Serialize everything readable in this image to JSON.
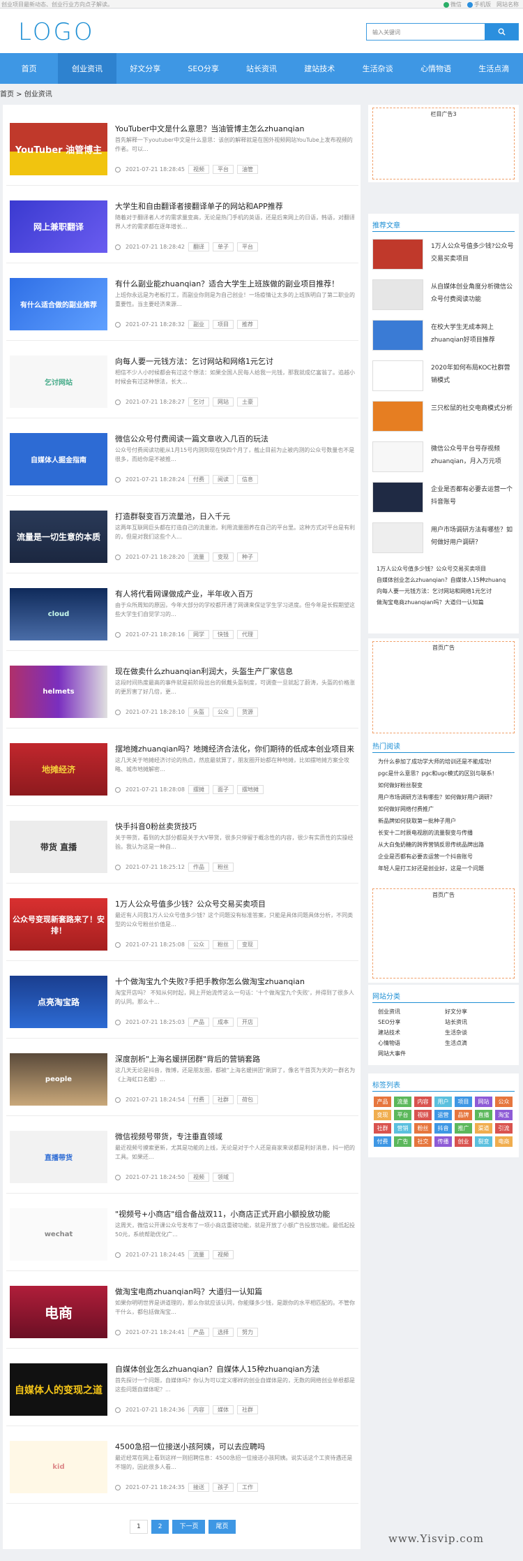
{
  "topbar": {
    "notice": "创业项目最新动态、创业行业方向点子解读。",
    "links": [
      {
        "label": "微信",
        "color": "#2aae67"
      },
      {
        "label": "手机版",
        "color": "#2b8fde"
      },
      {
        "label": "网站名称",
        "color": ""
      }
    ]
  },
  "header": {
    "logo": "LOGO",
    "search_placeholder": "输入关键词"
  },
  "nav": [
    "首页",
    "创业资讯",
    "好文分享",
    "SEO分享",
    "站长资讯",
    "建站技术",
    "生活杂谈",
    "心情物语",
    "生活点滴"
  ],
  "breadcrumb": "首页 > 创业资讯",
  "posts": [
    {
      "title": "YouTuber中文是什么意思？当油管博主怎么zhuanqian",
      "excerpt": "首先解释一下youtuber中文是什么意思：该创的解释就是在国外视频网站YouTube上发布视频的作者。可以...",
      "date": "2021-07-21 18:28:45",
      "tags": [
        "视频",
        "平台",
        "油管"
      ],
      "thumb_text": "YouTuber 油管博主"
    },
    {
      "title": "大学生和自由翻译者接翻译单子的网站和APP推荐",
      "excerpt": "随着对于翻译者人才的需求量变高，无论是热门手机的英语，还是后来网上的日语，韩语，对翻译界人才的需求都在逐年增长...",
      "date": "2021-07-21 18:28:42",
      "tags": [
        "翻译",
        "单子",
        "平台"
      ],
      "thumb_text": "网上兼职翻译"
    },
    {
      "title": "有什么副业能zhuanqian？适合大学生上班族做的副业项目推荐！",
      "excerpt": "上班你永远是为老板打工，而副业你则是为自己创业！一场疫情让太多的上班族明白了第二职业的重要性。当主要经济来源...",
      "date": "2021-07-21 18:28:32",
      "tags": [
        "副业",
        "项目",
        "推荐"
      ],
      "thumb_text": "有什么适合做的副业推荐"
    },
    {
      "title": "向每人要一元钱方法：乞讨网站和网络1元乞讨",
      "excerpt": "相信不少人小时候都会有过这个想法：如果全国人民每人给我一元钱，那我就成亿富翁了。追越小时候会有过这种想法，长大...",
      "date": "2021-07-21 18:28:27",
      "tags": [
        "乞讨",
        "网站",
        "土豪"
      ],
      "thumb_text": "乞讨网站"
    },
    {
      "title": "微信公众号付费阅读一篇文章收入几百的玩法",
      "excerpt": "公众号付费阅读功能从1月15号内测到现在快四个月了，截止目前为止被内测的公众号数量也不是很多，而给你是不被推...",
      "date": "2021-07-21 18:28:24",
      "tags": [
        "付费",
        "阅读",
        "信息"
      ],
      "thumb_text": "自媒体人掘金指南"
    },
    {
      "title": "打造群裂变百万流量池，日入千元",
      "excerpt": "这两年互联网巨头都在打造自己的流量池，利用流量圈养在自己的平台里。这种方式对平台是有利的，但是对我们这些个人...",
      "date": "2021-07-21 18:28:20",
      "tags": [
        "流量",
        "变现",
        "种子"
      ],
      "thumb_text": "流量是一切生意的本质"
    },
    {
      "title": "有人将代看网课做成产业，半年收入百万",
      "excerpt": "由于众所周知的原因，今年大部分的学校都开通了网课来保证学生学习进度。但今年是长假期望这些大学生们自觉学习的...",
      "date": "2021-07-21 18:28:16",
      "tags": [
        "网学",
        "快钱",
        "代理"
      ],
      "thumb_text": "cloud"
    },
    {
      "title": "现在做卖什么zhuanqian利润大，头盔生产厂家信息",
      "excerpt": "这段时间热度最高的事件就是前阶段出台的佩戴头盔制度，可调查一旦就起了蔚涛，头盔的价格涨的更厉害了好几倍，更...",
      "date": "2021-07-21 18:28:10",
      "tags": [
        "头盔",
        "公众",
        "货源"
      ],
      "thumb_text": "helmets"
    },
    {
      "title": "摆地摊zhuanqian吗？地摊经济合法化，你们期待的低成本创业项目来",
      "excerpt": "这几天关于地摊经济讨论的热点，然底最就算了，朋友圈开始都在种地摊，比如摆地摊方案全攻略、城市地摊解密...",
      "date": "2021-07-21 18:28:08",
      "tags": [
        "摆摊",
        "面子",
        "摆地摊"
      ],
      "thumb_text": "地摊经济"
    },
    {
      "title": "快手抖音0粉丝卖货技巧",
      "excerpt": "关于带货，看到的大部分都是关于大V带货，很多只停留于概念性的内容，很少有实质性的实操经验。我认为这是一种自...",
      "date": "2021-07-21 18:25:12",
      "tags": [
        "作品",
        "粉丝"
      ],
      "thumb_text": "带货 直播"
    },
    {
      "title": "1万人公众号值多少钱？公众号交易买卖项目",
      "excerpt": "最近有人问我1万人公众号值多少钱？这个问题没有标准答案，只能是具体问题具体分析，不同类型的公众号粉丝价值是...",
      "date": "2021-07-21 18:25:08",
      "tags": [
        "公众",
        "粉丝",
        "变现"
      ],
      "thumb_text": "公众号变现新套路来了！安排！"
    },
    {
      "title": "十个做淘宝九个失败?手把手教你怎么做淘宝zhuanqian",
      "excerpt": "淘宝开店吗？ 不知从何时起，网上开始流传这么一句话：'十个做淘宝九个失败'，并得到了很多人的认同。那么十...",
      "date": "2021-07-21 18:25:03",
      "tags": [
        "产品",
        "成本",
        "开店"
      ],
      "thumb_text": "点亮淘宝路"
    },
    {
      "title": "深度剖析\"上海名媛拼团群\"背后的营销套路",
      "excerpt": "这几天无论是抖音，微博，还是朋友圈，都被“上海名媛拼团”刷屏了，像名干首页为天的一群名为《上海虹口名媛》...",
      "date": "2021-07-21 18:24:54",
      "tags": [
        "付费",
        "社群",
        "荷包"
      ],
      "thumb_text": "people"
    },
    {
      "title": "微信视频号带货，专注垂直领域",
      "excerpt": "最近视频号摸索更新，尤其是功能的上线，无论是对于个人还是商家来说都是利好消息，抖一把的工具。如果还...",
      "date": "2021-07-21 18:24:50",
      "tags": [
        "视频",
        "领域"
      ],
      "thumb_text": "直播带货"
    },
    {
      "title": "\"视频号+小商店\"组合备战双11，小商店正式开启小额投放功能",
      "excerpt": "这周天，微信公开课公众号发布了一项小商店重磅功能，就是开放了小额广告投放功能。最低起投50元，系统帮助优化广...",
      "date": "2021-07-21 18:24:45",
      "tags": [
        "流量",
        "视频"
      ],
      "thumb_text": "wechat"
    },
    {
      "title": "做淘宝电商zhuanqian吗？大道归一认知篇",
      "excerpt": "如果你明明世界是讲道理的，那么你就应该认同，你能赚多少钱，是跟你的水平相匹配的。不管你干什么，都包括做淘宝...",
      "date": "2021-07-21 18:24:41",
      "tags": [
        "产品",
        "选择",
        "努力"
      ],
      "thumb_text": "电商"
    },
    {
      "title": "自媒体创业怎么zhuanqian？自媒体人15种zhuanqian方法",
      "excerpt": "首先探讨一个问题，自媒体吗？你认为可以定义哪样的创业自媒体是的，无数的网络创业单根都是这些问题自媒体呢？...",
      "date": "2021-07-21 18:24:36",
      "tags": [
        "内容",
        "媒体",
        "社群"
      ],
      "thumb_text": "自媒体人的变现之道"
    },
    {
      "title": "4500急招一位接送小孩阿姨，可以去应聘吗",
      "excerpt": "最近经常在网上看到这样一则招聘信息：4500急招一位接送小孩阿姨。说实话这个工资待遇还是不错的，因此很多人看...",
      "date": "2021-07-21 18:24:35",
      "tags": [
        "接送",
        "孩子",
        "工作"
      ],
      "thumb_text": "kid"
    }
  ],
  "pager": [
    "1",
    "2",
    "下一页",
    "尾页"
  ],
  "sidebar": {
    "ad_top": "栏目广告3",
    "recommend_title": "推荐文章",
    "recommend": [
      {
        "title": "1万人公众号值多少钱?公众号交易买卖项目"
      },
      {
        "title": "从自媒体创业角度分析微信公众号付费阅读功能"
      },
      {
        "title": "在校大学生无成本网上zhuanqian好项目推荐"
      },
      {
        "title": "2020年如何布局KOC社群营销模式"
      },
      {
        "title": "三只松鼠的社交电商模式分析"
      },
      {
        "title": "微信公众号平台号存视频zhuanqian，月入万元项"
      },
      {
        "title": "企业是否都有必要去运营一个抖音账号"
      },
      {
        "title": "用户市场调研方法有哪些？如何做好用户调研？"
      }
    ],
    "recommend_links": [
      "1万人公众号值多少钱？公众号交易买卖项目",
      "自媒体创业怎么zhuanqian？自媒体人15种zhuanq",
      "向每人要一元钱方法：乞讨网站和网络1元乞讨",
      "做淘宝电商zhuanqian吗？大道归一认知篇"
    ],
    "ad_mid": "首页广告",
    "hot_title": "热门阅读",
    "hot": [
      "为什么参加了成功学大师的培训还是不能成功!",
      "pgc是什么意思？pgc和ugc模式的区别与联系!",
      "如何做好粉丝裂变",
      "用户市场调研方法有哪些？如何做好用户调研？",
      "如何做好网络付费推广",
      "新品牌如何获取第一批种子用户",
      "长安十二时辰电视剧的流量裂变与传播",
      "从大白兔奶糖的跨界营销反思传统品牌出路",
      "企业是否都有必要去运营一个抖音账号",
      "年轻人是打工好还是创业好，这是一个问题"
    ],
    "ad_low": "首页广告",
    "cat_title": "网站分类",
    "cats": [
      "创业资讯",
      "好文分享",
      "SEO分享",
      "站长资讯",
      "建站技术",
      "生活杂谈",
      "心情物语",
      "生活点滴",
      "网站大事件"
    ],
    "tag_title": "标签列表",
    "tags": [
      {
        "t": "产品",
        "c": "#e6763e"
      },
      {
        "t": "流量",
        "c": "#5cb85c"
      },
      {
        "t": "内容",
        "c": "#d9534f"
      },
      {
        "t": "用户",
        "c": "#5bc0de"
      },
      {
        "t": "项目",
        "c": "#3e97e4"
      },
      {
        "t": "网站",
        "c": "#8e5bd6"
      },
      {
        "t": "公众",
        "c": "#e6763e"
      },
      {
        "t": "变现",
        "c": "#f0ad4e"
      },
      {
        "t": "平台",
        "c": "#5cb85c"
      },
      {
        "t": "视频",
        "c": "#d9534f"
      },
      {
        "t": "运营",
        "c": "#3e97e4"
      },
      {
        "t": "品牌",
        "c": "#e6763e"
      },
      {
        "t": "直播",
        "c": "#5cb85c"
      },
      {
        "t": "淘宝",
        "c": "#8e5bd6"
      },
      {
        "t": "社群",
        "c": "#d9534f"
      },
      {
        "t": "营销",
        "c": "#5bc0de"
      },
      {
        "t": "粉丝",
        "c": "#e6763e"
      },
      {
        "t": "抖音",
        "c": "#3e97e4"
      },
      {
        "t": "推广",
        "c": "#5cb85c"
      },
      {
        "t": "渠道",
        "c": "#f0ad4e"
      },
      {
        "t": "引流",
        "c": "#d9534f"
      },
      {
        "t": "付费",
        "c": "#3e97e4"
      },
      {
        "t": "广告",
        "c": "#5cb85c"
      },
      {
        "t": "社交",
        "c": "#e6763e"
      },
      {
        "t": "传播",
        "c": "#8e5bd6"
      },
      {
        "t": "创业",
        "c": "#d9534f"
      },
      {
        "t": "裂变",
        "c": "#5bc0de"
      },
      {
        "t": "电商",
        "c": "#f0ad4e"
      }
    ]
  },
  "watermark": "www.Yisvip.com"
}
